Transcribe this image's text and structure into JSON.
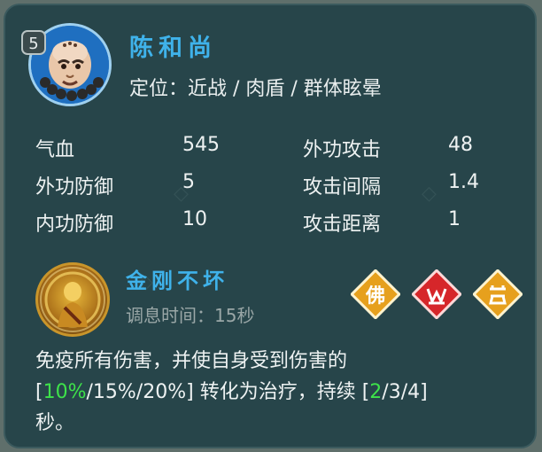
{
  "hero": {
    "level": "5",
    "name": "陈和尚",
    "role": "定位：近战 / 肉盾 / 群体眩晕"
  },
  "stats": [
    {
      "label": "气血",
      "value": "545"
    },
    {
      "label": "外功攻击",
      "value": "48"
    },
    {
      "label": "外功防御",
      "value": "5"
    },
    {
      "label": "攻击间隔",
      "value": "1.4"
    },
    {
      "label": "内功防御",
      "value": "10"
    },
    {
      "label": "攻击距离",
      "value": "1"
    }
  ],
  "skill": {
    "name": "金刚不坏",
    "cooldown": "调息时间：15秒",
    "desc_line1": "免疫所有伤害，并使自身受到伤害的",
    "desc_line2_open": "[",
    "desc_line2_hl1": "10%",
    "desc_line2_mid": "/15%/20%] 转化为治疗，持续 [",
    "desc_line2_hl2": "2",
    "desc_line2_close": "/3/4]",
    "desc_line3": "秒。"
  },
  "badges": [
    {
      "icon": "buddha-badge-icon",
      "glyph": "佛",
      "color": "#e6a01d"
    },
    {
      "icon": "claw-badge-icon",
      "color": "#d6262a"
    },
    {
      "icon": "tower-badge-icon",
      "color": "#e6a01d"
    }
  ],
  "colors": {
    "panel": "#27454a",
    "title": "#3fb2ea",
    "highlight": "#3ee24a"
  }
}
